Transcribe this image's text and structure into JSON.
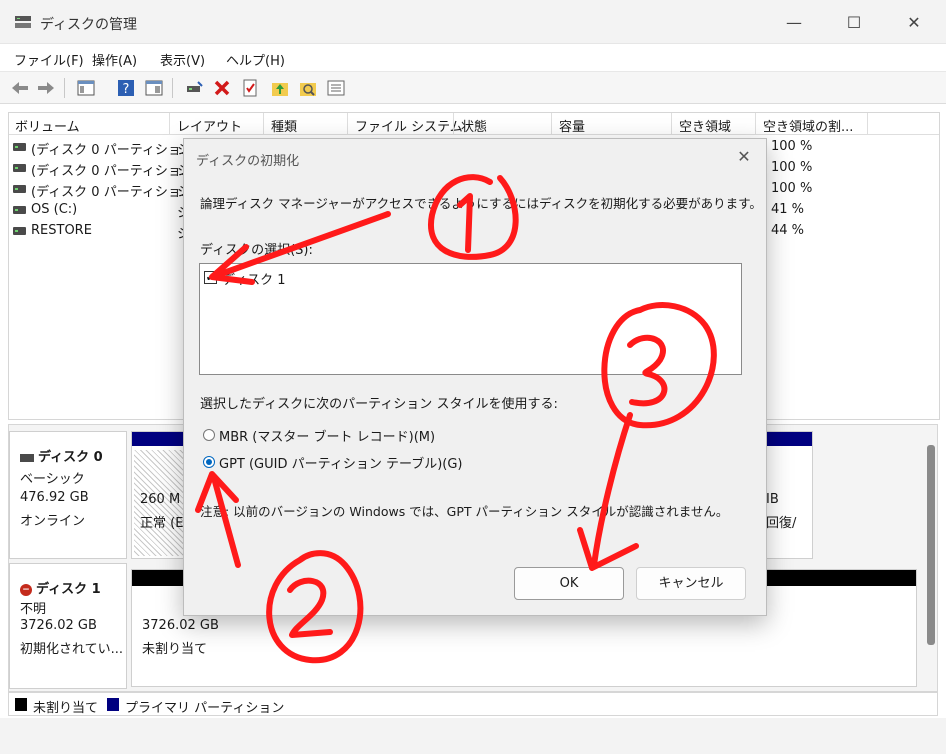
{
  "window": {
    "title": "ディスクの管理",
    "min": "—",
    "max": "☐",
    "close": "✕"
  },
  "menu": [
    "ファイル(F)",
    "操作(A)",
    "表示(V)",
    "ヘルプ(H)"
  ],
  "volume_list": {
    "columns": [
      "ボリューム",
      "レイアウト",
      "種類",
      "ファイル システム",
      "状態",
      "容量",
      "空き領域",
      "空き領域の割..."
    ],
    "rows": [
      {
        "name": "(ディスク 0 パーティショ...",
        "layout": "シ",
        "free_pct": "100 %"
      },
      {
        "name": "(ディスク 0 パーティショ...",
        "layout": "シ",
        "free_pct": "100 %"
      },
      {
        "name": "(ディスク 0 パーティショ...",
        "layout": "シ",
        "free_pct": "100 %"
      },
      {
        "name": "OS (C:)",
        "layout": "シ",
        "free_pct": "41 %"
      },
      {
        "name": "RESTORE",
        "layout": "シ",
        "free_pct": "44 %"
      }
    ]
  },
  "disks": [
    {
      "name": "ディスク 0",
      "type": "ベーシック",
      "size": "476.92 GB",
      "status": "オンライン",
      "part_left": {
        "size": "260 M",
        "status": "正常 (E"
      },
      "part_right": {
        "size": "IB",
        "status": "回復/"
      }
    },
    {
      "name": "ディスク 1",
      "type": "不明",
      "size": "3726.02 GB",
      "status": "初期化されてい...",
      "unallocated": {
        "size": "3726.02 GB",
        "label": "未割り当て"
      }
    }
  ],
  "legend": [
    {
      "label": "未割り当て",
      "color": "#000000"
    },
    {
      "label": "プライマリ パーティション",
      "color": "#000080"
    }
  ],
  "dialog": {
    "title": "ディスクの初期化",
    "close": "✕",
    "message": "論理ディスク マネージャーがアクセスできるようにするにはディスクを初期化する必要があります。",
    "select_label": "ディスクの選択(S):",
    "disks": [
      {
        "label": "ディスク 1",
        "checked": true,
        "check": "✔"
      }
    ],
    "style_label": "選択したディスクに次のパーティション スタイルを使用する:",
    "options": [
      {
        "label": "MBR (マスター ブート レコード)(M)",
        "selected": false
      },
      {
        "label": "GPT (GUID パーティション テーブル)(G)",
        "selected": true
      }
    ],
    "note": "注意: 以前のバージョンの Windows では、GPT パーティション スタイルが認識されません。",
    "ok": "OK",
    "cancel": "キャンセル"
  },
  "annotations": {
    "color": "#ff1a1a",
    "marks": [
      "①",
      "②",
      "③"
    ]
  }
}
